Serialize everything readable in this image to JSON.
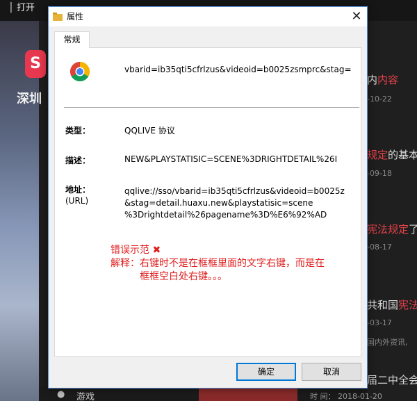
{
  "background": {
    "top_title": "│ 打开",
    "logo_text": "深圳",
    "news": [
      {
        "text": "内",
        "highlight": "内容",
        "date": "-10-22"
      },
      {
        "text": "",
        "highlight": "规定",
        "rest": "的基本",
        "date": "-09-18"
      },
      {
        "text": "",
        "highlight": "宪法规定",
        "rest": "了",
        "date": "-08-17"
      },
      {
        "text": "共和国",
        "highlight": "宪法",
        "date": "-03-17"
      },
      {
        "text": "国内外资讯,"
      },
      {
        "text": "届二中全会"
      }
    ],
    "game_label": "游戏",
    "time_text": "时  间： 2018-01-20"
  },
  "dialog": {
    "title": "属性",
    "close_glyph": "✕",
    "tab_label": "常规",
    "url_header": "vbarid=ib35qti5cfrlzus&videoid=b0025zsmprc&stag=",
    "properties": {
      "type_label": "类型：",
      "type_value": "QQLIVE 协议",
      "desc_label": "描述：",
      "desc_value": "NEW&PLAYSTATISIC=SCENE%3DRIGHTDETAIL%26I",
      "addr_label": "地址：",
      "addr_label_sub": "(URL)",
      "addr_lines": [
        "qqlive://sso/vbarid=ib35qti5cfrlzus&videoid=b0025z",
        "&stag=detail.huaxu.new&playstatisic=scene",
        "%3Drightdetail%26pagename%3D%E6%92%AD"
      ]
    },
    "annotation": {
      "line1": "错误示范",
      "x_mark": "✖",
      "line2": "解释：右键时不是在框框里面的文字右键，而是在",
      "line3": "框框空白处右键。。。"
    },
    "ok_label": "确定",
    "cancel_label": "取消"
  },
  "colors": {
    "annotation_red": "#e02020",
    "accent_blue": "#0078d7",
    "news_highlight": "#e8424a"
  }
}
